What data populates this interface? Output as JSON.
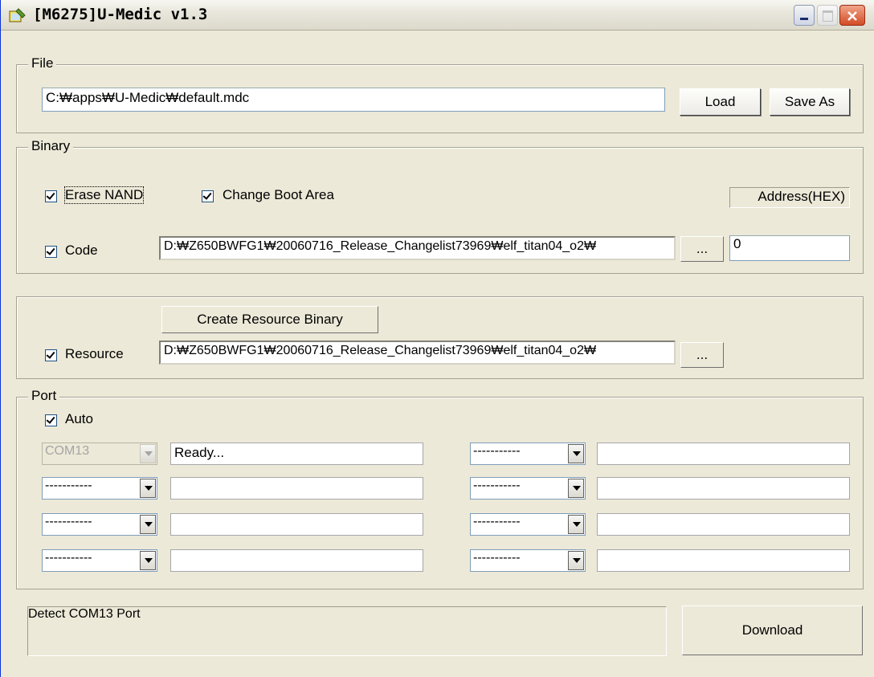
{
  "window": {
    "title": "[M6275]U-Medic v1.3"
  },
  "file": {
    "legend": "File",
    "path": "C:₩apps₩U-Medic₩default.mdc",
    "load_label": "Load",
    "save_as_label": "Save As"
  },
  "binary": {
    "legend": "Binary",
    "erase_nand_label": "Erase NAND",
    "erase_nand_checked": true,
    "change_boot_label": "Change Boot Area",
    "change_boot_checked": true,
    "address_label": "Address(HEX)",
    "code_label": "Code",
    "code_checked": true,
    "code_path": "D:₩Z650BWFG1₩20060716_Release_Changelist73969₩elf_titan04_o2₩",
    "browse_label": "...",
    "address_value": "0"
  },
  "resource": {
    "create_label": "Create Resource Binary",
    "label": "Resource",
    "checked": true,
    "path": "D:₩Z650BWFG1₩20060716_Release_Changelist73969₩elf_titan04_o2₩",
    "browse_label": "..."
  },
  "port": {
    "legend": "Port",
    "auto_label": "Auto",
    "auto_checked": true,
    "left": [
      {
        "port": "COM13",
        "status": "Ready...",
        "disabled": true
      },
      {
        "port": "-----------",
        "status": ""
      },
      {
        "port": "-----------",
        "status": ""
      },
      {
        "port": "-----------",
        "status": ""
      }
    ],
    "right": [
      {
        "port": "-----------",
        "status": ""
      },
      {
        "port": "-----------",
        "status": ""
      },
      {
        "port": "-----------",
        "status": ""
      },
      {
        "port": "-----------",
        "status": ""
      }
    ]
  },
  "footer": {
    "message": "Detect COM13 Port",
    "download_label": "Download"
  }
}
